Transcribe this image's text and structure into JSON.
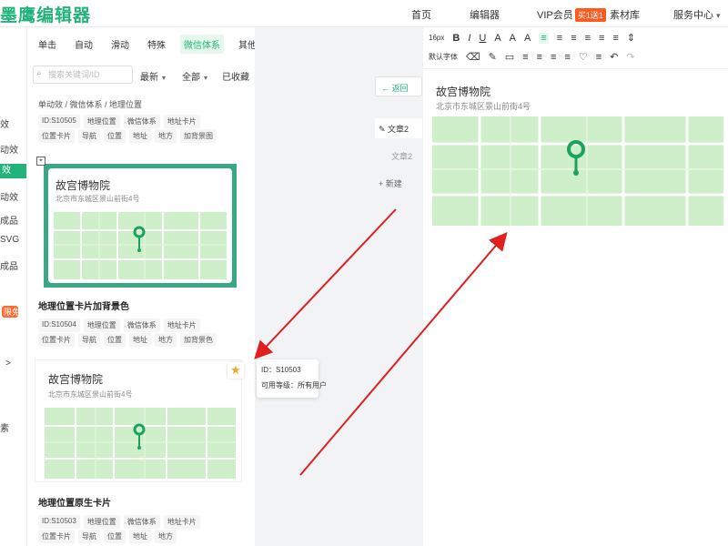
{
  "app": {
    "logo_text": "墨鹰编辑器",
    "nav": {
      "home": "首页",
      "editor": "编辑器",
      "vip": "VIP会员",
      "vip_badge": "买1送1",
      "materials": "素材库",
      "service": "服务中心"
    }
  },
  "left_strip": {
    "items": [
      "效",
      "动效",
      "效",
      "动效",
      "成品",
      "SVG",
      "成品",
      "限免",
      ">",
      "素"
    ]
  },
  "style_panel": {
    "category_tabs": [
      "单击",
      "自动",
      "滑动",
      "特殊",
      "微信体系",
      "其他"
    ],
    "active_tab": "微信体系",
    "search": {
      "placeholder": "搜索关键词/ID"
    },
    "filters": {
      "sort": "最新",
      "scope": "全部",
      "favorited": "已收藏"
    },
    "breadcrumb": "单动效 / 微信体系 / 地理位置",
    "group_top": {
      "tags": [
        "ID:S10505",
        "地理位置",
        "微信体系",
        "地址卡片",
        "位置卡片",
        "导航",
        "位置",
        "地址",
        "地方",
        "加背景图"
      ]
    },
    "card1": {
      "name": "故宫博物院",
      "address": "北京市东城区景山前街4号",
      "title": "地理位置卡片加背景色",
      "tags": [
        "ID:S10504",
        "地理位置",
        "微信体系",
        "地址卡片",
        "位置卡片",
        "导航",
        "位置",
        "地址",
        "地方",
        "加背景色"
      ]
    },
    "card2": {
      "name": "故宫博物院",
      "address": "北京市东城区景山前街4号",
      "title": "地理位置原生卡片",
      "tags": [
        "ID:S10503",
        "地理位置",
        "微信体系",
        "地址卡片",
        "位置卡片",
        "导航",
        "位置",
        "地址",
        "地方"
      ]
    },
    "tooltip": {
      "id_line": "ID：S10503",
      "level_line": "可用等级：所有用户"
    }
  },
  "docs": {
    "back": "← 返回",
    "items": [
      "文章2",
      "文章2"
    ],
    "new": "+ 新建"
  },
  "toolbar": {
    "row1": [
      "16px",
      "B",
      "I",
      "U",
      "A",
      "A",
      "A",
      "≡",
      "≡",
      "≡",
      "≡",
      "≡",
      "≡",
      "⇕"
    ],
    "row2": [
      "默认字体",
      "⌫",
      "✎",
      "▭",
      "≡",
      "≡",
      "≡",
      "≡",
      "♡",
      "≡",
      "↶",
      "↷"
    ]
  },
  "editor_card": {
    "name": "故宫博物院",
    "address": "北京市东城区景山前街4号"
  },
  "colors": {
    "brand": "#22b37a",
    "card_bg": "#3aa983",
    "map_bg": "#cfeeca",
    "pin": "#19a35e",
    "arrow": "#e02020",
    "vip_badge": "#ff5a1f"
  }
}
